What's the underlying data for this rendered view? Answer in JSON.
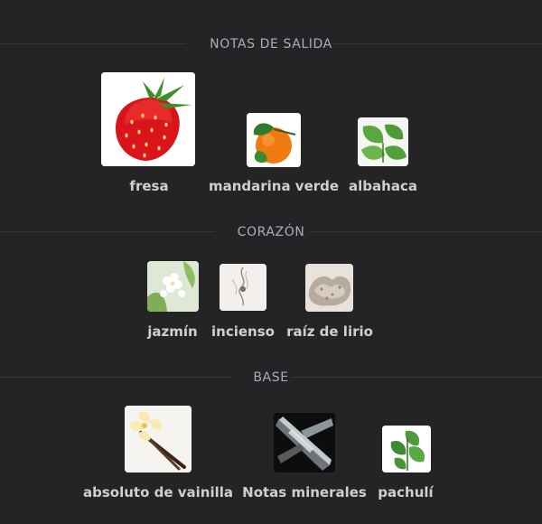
{
  "sections": [
    {
      "title": "NOTAS DE SALIDA",
      "notes": [
        {
          "label": "fresa",
          "icon": "strawberry-icon"
        },
        {
          "label": "mandarina verde",
          "icon": "mandarin-icon"
        },
        {
          "label": "albahaca",
          "icon": "basil-icon"
        }
      ]
    },
    {
      "title": "CORAZÓN",
      "notes": [
        {
          "label": "jazmín",
          "icon": "jasmine-icon"
        },
        {
          "label": "incienso",
          "icon": "incense-icon"
        },
        {
          "label": "raíz de lirio",
          "icon": "orris-root-icon"
        }
      ]
    },
    {
      "title": "BASE",
      "notes": [
        {
          "label": "absoluto de vainilla",
          "icon": "vanilla-icon"
        },
        {
          "label": "Notas minerales",
          "icon": "minerals-icon"
        },
        {
          "label": "pachulí",
          "icon": "patchouli-icon"
        }
      ]
    }
  ],
  "colors": {
    "background": "#242426",
    "header_text": "#a9afb8",
    "label_text": "#cfcfd2"
  }
}
